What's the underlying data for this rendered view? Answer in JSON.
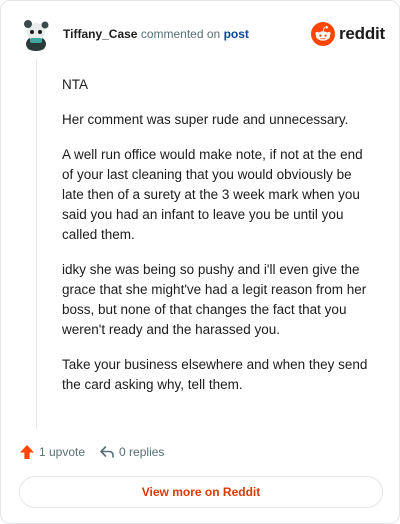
{
  "comment": {
    "author": "Tiffany_Case",
    "verb": "commented on",
    "target": "post",
    "paragraphs": [
      "NTA",
      "Her comment was super rude and unnecessary.",
      "A well run office would make note, if not at the end of your last cleaning that you would obviously be late then of a surety at the 3 week mark when you said you had an infant to leave you be until you called them.",
      "idky she was being so pushy and i'll even give the grace that she might've had a legit reason from her boss, but none of that changes the fact that you weren't ready and the harassed you.",
      "Take your business elsewhere and when they send the card asking why, tell them."
    ]
  },
  "brand": {
    "name": "reddit",
    "icon": "reddit-snoo-icon",
    "color": "#ff4500"
  },
  "actions": {
    "upvotes": "1 upvote",
    "replies": "0 replies"
  },
  "footer": {
    "view_more": "View more on Reddit",
    "color": "#d93a00"
  }
}
